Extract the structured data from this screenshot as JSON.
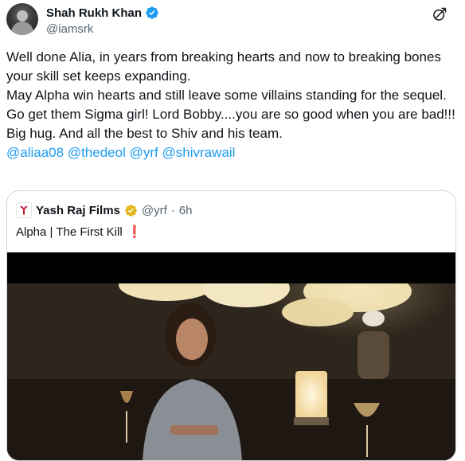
{
  "author": {
    "display_name": "Shah Rukh Khan",
    "handle": "@iamsrk",
    "verified": true,
    "avatar_icon": "avatar-photo",
    "grok_icon": "grok-icon"
  },
  "tweet": {
    "lines": [
      "Well done Alia, in years from breaking hearts and now to breaking bones your skill set keeps expanding.",
      "May Alpha win hearts and still leave some villains standing for the sequel.",
      "Go get them Sigma girl! Lord Bobby....you are so good when you are bad!!!",
      "Big hug. And all the best to Shiv and his team."
    ],
    "mentions": [
      "@aliaa08",
      "@thedeol",
      "@yrf",
      "@shivrawail"
    ]
  },
  "quoted": {
    "display_name": "Yash Raj Films",
    "handle": "@yrf",
    "separator": "·",
    "time": "6h",
    "text": "Alpha | The First Kill",
    "emoji": "❗",
    "verified_badge": "gold-verified-icon",
    "logo_icon": "yrf-logo-icon",
    "media_description_icon": "video-thumbnail"
  },
  "colors": {
    "link": "#1d9bf0",
    "verified_blue": "#1d9bf0",
    "verified_gold": "#e2b719",
    "secondary_text": "#536471"
  }
}
